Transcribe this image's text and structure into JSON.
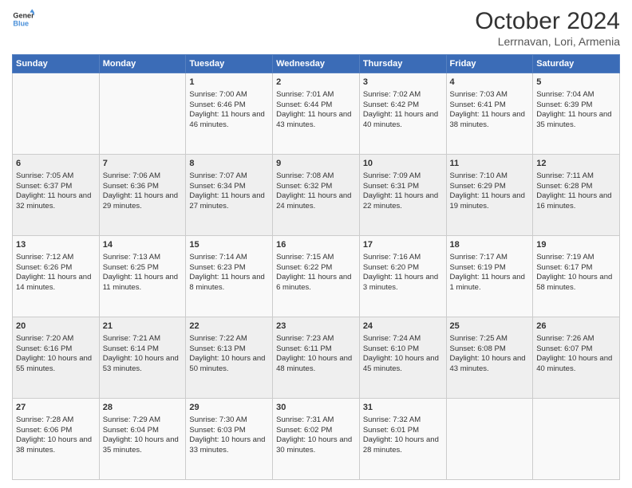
{
  "header": {
    "logo_line1": "General",
    "logo_line2": "Blue",
    "title": "October 2024",
    "location": "Lerrnavan, Lori, Armenia"
  },
  "days_of_week": [
    "Sunday",
    "Monday",
    "Tuesday",
    "Wednesday",
    "Thursday",
    "Friday",
    "Saturday"
  ],
  "weeks": [
    [
      {
        "day": "",
        "sunrise": "",
        "sunset": "",
        "daylight": ""
      },
      {
        "day": "",
        "sunrise": "",
        "sunset": "",
        "daylight": ""
      },
      {
        "day": "1",
        "sunrise": "Sunrise: 7:00 AM",
        "sunset": "Sunset: 6:46 PM",
        "daylight": "Daylight: 11 hours and 46 minutes."
      },
      {
        "day": "2",
        "sunrise": "Sunrise: 7:01 AM",
        "sunset": "Sunset: 6:44 PM",
        "daylight": "Daylight: 11 hours and 43 minutes."
      },
      {
        "day": "3",
        "sunrise": "Sunrise: 7:02 AM",
        "sunset": "Sunset: 6:42 PM",
        "daylight": "Daylight: 11 hours and 40 minutes."
      },
      {
        "day": "4",
        "sunrise": "Sunrise: 7:03 AM",
        "sunset": "Sunset: 6:41 PM",
        "daylight": "Daylight: 11 hours and 38 minutes."
      },
      {
        "day": "5",
        "sunrise": "Sunrise: 7:04 AM",
        "sunset": "Sunset: 6:39 PM",
        "daylight": "Daylight: 11 hours and 35 minutes."
      }
    ],
    [
      {
        "day": "6",
        "sunrise": "Sunrise: 7:05 AM",
        "sunset": "Sunset: 6:37 PM",
        "daylight": "Daylight: 11 hours and 32 minutes."
      },
      {
        "day": "7",
        "sunrise": "Sunrise: 7:06 AM",
        "sunset": "Sunset: 6:36 PM",
        "daylight": "Daylight: 11 hours and 29 minutes."
      },
      {
        "day": "8",
        "sunrise": "Sunrise: 7:07 AM",
        "sunset": "Sunset: 6:34 PM",
        "daylight": "Daylight: 11 hours and 27 minutes."
      },
      {
        "day": "9",
        "sunrise": "Sunrise: 7:08 AM",
        "sunset": "Sunset: 6:32 PM",
        "daylight": "Daylight: 11 hours and 24 minutes."
      },
      {
        "day": "10",
        "sunrise": "Sunrise: 7:09 AM",
        "sunset": "Sunset: 6:31 PM",
        "daylight": "Daylight: 11 hours and 22 minutes."
      },
      {
        "day": "11",
        "sunrise": "Sunrise: 7:10 AM",
        "sunset": "Sunset: 6:29 PM",
        "daylight": "Daylight: 11 hours and 19 minutes."
      },
      {
        "day": "12",
        "sunrise": "Sunrise: 7:11 AM",
        "sunset": "Sunset: 6:28 PM",
        "daylight": "Daylight: 11 hours and 16 minutes."
      }
    ],
    [
      {
        "day": "13",
        "sunrise": "Sunrise: 7:12 AM",
        "sunset": "Sunset: 6:26 PM",
        "daylight": "Daylight: 11 hours and 14 minutes."
      },
      {
        "day": "14",
        "sunrise": "Sunrise: 7:13 AM",
        "sunset": "Sunset: 6:25 PM",
        "daylight": "Daylight: 11 hours and 11 minutes."
      },
      {
        "day": "15",
        "sunrise": "Sunrise: 7:14 AM",
        "sunset": "Sunset: 6:23 PM",
        "daylight": "Daylight: 11 hours and 8 minutes."
      },
      {
        "day": "16",
        "sunrise": "Sunrise: 7:15 AM",
        "sunset": "Sunset: 6:22 PM",
        "daylight": "Daylight: 11 hours and 6 minutes."
      },
      {
        "day": "17",
        "sunrise": "Sunrise: 7:16 AM",
        "sunset": "Sunset: 6:20 PM",
        "daylight": "Daylight: 11 hours and 3 minutes."
      },
      {
        "day": "18",
        "sunrise": "Sunrise: 7:17 AM",
        "sunset": "Sunset: 6:19 PM",
        "daylight": "Daylight: 11 hours and 1 minute."
      },
      {
        "day": "19",
        "sunrise": "Sunrise: 7:19 AM",
        "sunset": "Sunset: 6:17 PM",
        "daylight": "Daylight: 10 hours and 58 minutes."
      }
    ],
    [
      {
        "day": "20",
        "sunrise": "Sunrise: 7:20 AM",
        "sunset": "Sunset: 6:16 PM",
        "daylight": "Daylight: 10 hours and 55 minutes."
      },
      {
        "day": "21",
        "sunrise": "Sunrise: 7:21 AM",
        "sunset": "Sunset: 6:14 PM",
        "daylight": "Daylight: 10 hours and 53 minutes."
      },
      {
        "day": "22",
        "sunrise": "Sunrise: 7:22 AM",
        "sunset": "Sunset: 6:13 PM",
        "daylight": "Daylight: 10 hours and 50 minutes."
      },
      {
        "day": "23",
        "sunrise": "Sunrise: 7:23 AM",
        "sunset": "Sunset: 6:11 PM",
        "daylight": "Daylight: 10 hours and 48 minutes."
      },
      {
        "day": "24",
        "sunrise": "Sunrise: 7:24 AM",
        "sunset": "Sunset: 6:10 PM",
        "daylight": "Daylight: 10 hours and 45 minutes."
      },
      {
        "day": "25",
        "sunrise": "Sunrise: 7:25 AM",
        "sunset": "Sunset: 6:08 PM",
        "daylight": "Daylight: 10 hours and 43 minutes."
      },
      {
        "day": "26",
        "sunrise": "Sunrise: 7:26 AM",
        "sunset": "Sunset: 6:07 PM",
        "daylight": "Daylight: 10 hours and 40 minutes."
      }
    ],
    [
      {
        "day": "27",
        "sunrise": "Sunrise: 7:28 AM",
        "sunset": "Sunset: 6:06 PM",
        "daylight": "Daylight: 10 hours and 38 minutes."
      },
      {
        "day": "28",
        "sunrise": "Sunrise: 7:29 AM",
        "sunset": "Sunset: 6:04 PM",
        "daylight": "Daylight: 10 hours and 35 minutes."
      },
      {
        "day": "29",
        "sunrise": "Sunrise: 7:30 AM",
        "sunset": "Sunset: 6:03 PM",
        "daylight": "Daylight: 10 hours and 33 minutes."
      },
      {
        "day": "30",
        "sunrise": "Sunrise: 7:31 AM",
        "sunset": "Sunset: 6:02 PM",
        "daylight": "Daylight: 10 hours and 30 minutes."
      },
      {
        "day": "31",
        "sunrise": "Sunrise: 7:32 AM",
        "sunset": "Sunset: 6:01 PM",
        "daylight": "Daylight: 10 hours and 28 minutes."
      },
      {
        "day": "",
        "sunrise": "",
        "sunset": "",
        "daylight": ""
      },
      {
        "day": "",
        "sunrise": "",
        "sunset": "",
        "daylight": ""
      }
    ]
  ]
}
